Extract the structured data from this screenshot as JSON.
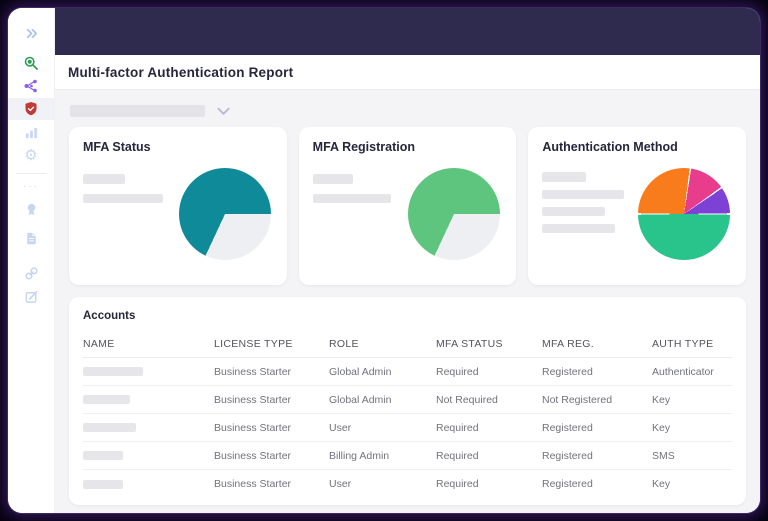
{
  "header": {
    "title": "Multi-factor Authentication Report"
  },
  "sidebar": {
    "icons": [
      "collapse-chevrons",
      "search",
      "network",
      "shield-security",
      "bar-chart",
      "settings-gear",
      "more-ellipsis",
      "badge",
      "document",
      "link",
      "edit"
    ],
    "active_icon": "shield-security",
    "ellipsis_glyph": "···",
    "gear_glyph": "⚙"
  },
  "filter": {
    "redacted": true
  },
  "cards": [
    {
      "title": "MFA Status",
      "legend_placeholders": 2
    },
    {
      "title": "MFA Registration",
      "legend_placeholders": 2
    },
    {
      "title": "Authentication Method",
      "legend_placeholders": 4
    }
  ],
  "chart_data": [
    {
      "type": "pie",
      "title": "MFA Status",
      "legend_redacted": true,
      "segments": [
        {
          "label": "segment-1",
          "pct": 68,
          "color": "#0f8a99"
        },
        {
          "label": "segment-2",
          "pct": 32,
          "color": "#edeff3"
        }
      ],
      "arcs": [
        {
          "color": "#0f8a99",
          "from": 0,
          "to": 90
        },
        {
          "color": "#edeff3",
          "from": 90,
          "to": 205
        },
        {
          "color": "#0f8a99",
          "from": 205,
          "to": 360
        }
      ]
    },
    {
      "type": "pie",
      "title": "MFA Registration",
      "legend_redacted": true,
      "segments": [
        {
          "label": "segment-1",
          "pct": 68,
          "color": "#5ec57f"
        },
        {
          "label": "segment-2",
          "pct": 32,
          "color": "#edeff3"
        }
      ],
      "arcs": [
        {
          "color": "#5ec57f",
          "from": 0,
          "to": 90
        },
        {
          "color": "#edeff3",
          "from": 90,
          "to": 205
        },
        {
          "color": "#5ec57f",
          "from": 205,
          "to": 360
        }
      ]
    },
    {
      "type": "pie",
      "title": "Authentication Method",
      "legend_redacted": true,
      "segments": [
        {
          "label": "segment-1",
          "pct": 13,
          "color": "#e83d8d"
        },
        {
          "label": "segment-2",
          "pct": 9,
          "color": "#7e41d6"
        },
        {
          "label": "segment-3",
          "pct": 50,
          "color": "#28c48b"
        },
        {
          "label": "segment-4",
          "pct": 28,
          "color": "#f97c1c"
        }
      ],
      "arcs": [
        {
          "color": "#f97c1c",
          "from": 0,
          "to": 7
        },
        {
          "color": "#ffffff",
          "from": 7,
          "to": 9
        },
        {
          "color": "#e83d8d",
          "from": 9,
          "to": 54
        },
        {
          "color": "#ffffff",
          "from": 54,
          "to": 56
        },
        {
          "color": "#7e41d6",
          "from": 56,
          "to": 89
        },
        {
          "color": "#ffffff",
          "from": 89,
          "to": 91
        },
        {
          "color": "#28c48b",
          "from": 91,
          "to": 269
        },
        {
          "color": "#ffffff",
          "from": 269,
          "to": 271
        },
        {
          "color": "#f97c1c",
          "from": 271,
          "to": 360
        }
      ]
    }
  ],
  "accounts": {
    "title": "Accounts",
    "columns": [
      "NAME",
      "LICENSE TYPE",
      "ROLE",
      "MFA STATUS",
      "MFA REG.",
      "AUTH TYPE"
    ],
    "rows": [
      {
        "name_redacted": true,
        "license": "Business Starter",
        "role": "Global Admin",
        "mfa_status": "Required",
        "mfa_reg": "Registered",
        "auth_type": "Authenticator"
      },
      {
        "name_redacted": true,
        "license": "Business Starter",
        "role": "Global Admin",
        "mfa_status": "Not Required",
        "mfa_reg": "Not Registered",
        "auth_type": "Key"
      },
      {
        "name_redacted": true,
        "license": "Business Starter",
        "role": "User",
        "mfa_status": "Required",
        "mfa_reg": "Registered",
        "auth_type": "Key"
      },
      {
        "name_redacted": true,
        "license": "Business Starter",
        "role": "Billing Admin",
        "mfa_status": "Required",
        "mfa_reg": "Registered",
        "auth_type": "SMS"
      },
      {
        "name_redacted": true,
        "license": "Business Starter",
        "role": "User",
        "mfa_status": "Required",
        "mfa_reg": "Registered",
        "auth_type": "Key"
      }
    ]
  },
  "colors": {
    "topbar": "#2f2b4e",
    "teal": "#0f8a99",
    "green": "#5ec57f",
    "pie_gray": "#edeff3",
    "auth_pink": "#e83d8d",
    "auth_purple": "#7e41d6",
    "auth_green": "#28c48b",
    "auth_orange": "#f97c1c",
    "icon_faded_blue": "#c5d6f3",
    "icon_search_green": "#2f9e55",
    "icon_network_purple": "#8a5cf6",
    "icon_shield_red": "#c13b35"
  }
}
